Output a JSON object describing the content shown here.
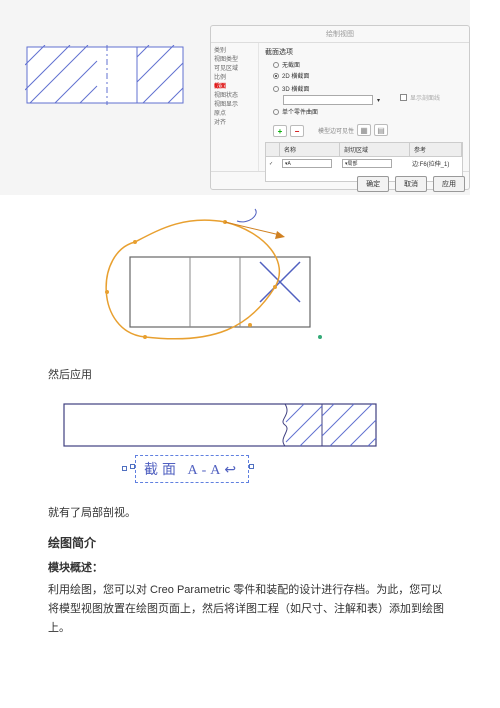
{
  "dialog": {
    "title": "绘制视图",
    "sidebar": {
      "items": [
        "类别",
        "视图类型",
        "可见区域",
        "比例",
        "截面",
        "视图状态",
        "视图显示",
        "原点",
        "对齐"
      ],
      "selected_index": 4
    },
    "main": {
      "section_heading": "截面选项",
      "radio_options": [
        "无截面",
        "2D 横截面",
        "3D 横截面",
        "单个零件曲面"
      ],
      "selected_radio": 1,
      "checkbox_show_line": "显示剖面线",
      "model_edge_vis_label": "模型边可见性",
      "add_tooltip": "+",
      "remove_tooltip": "−",
      "table_headers": {
        "col1": "",
        "col2": "名称",
        "col3": "剖切区域",
        "col4": "参考"
      },
      "table_row": {
        "chev": "▾",
        "name_opt": "A",
        "area_opt": "局部",
        "ref": "边:F6(拉伸_1)"
      }
    },
    "footer": {
      "ok": "确定",
      "cancel": "取消",
      "apply": "应用"
    }
  },
  "after_apply_text": "然后应用",
  "section_label_text": "截面  A-A",
  "result_text": "就有了局部剖视。",
  "intro_heading": "绘图简介",
  "module_heading": "模块概述：",
  "module_para": "利用绘图，您可以对 Creo Parametric 零件和装配的设计进行存档。为此，您可以将模型视图放置在绘图页面上，然后将详图工程（如尺寸、注解和表）添加到绘图上。"
}
